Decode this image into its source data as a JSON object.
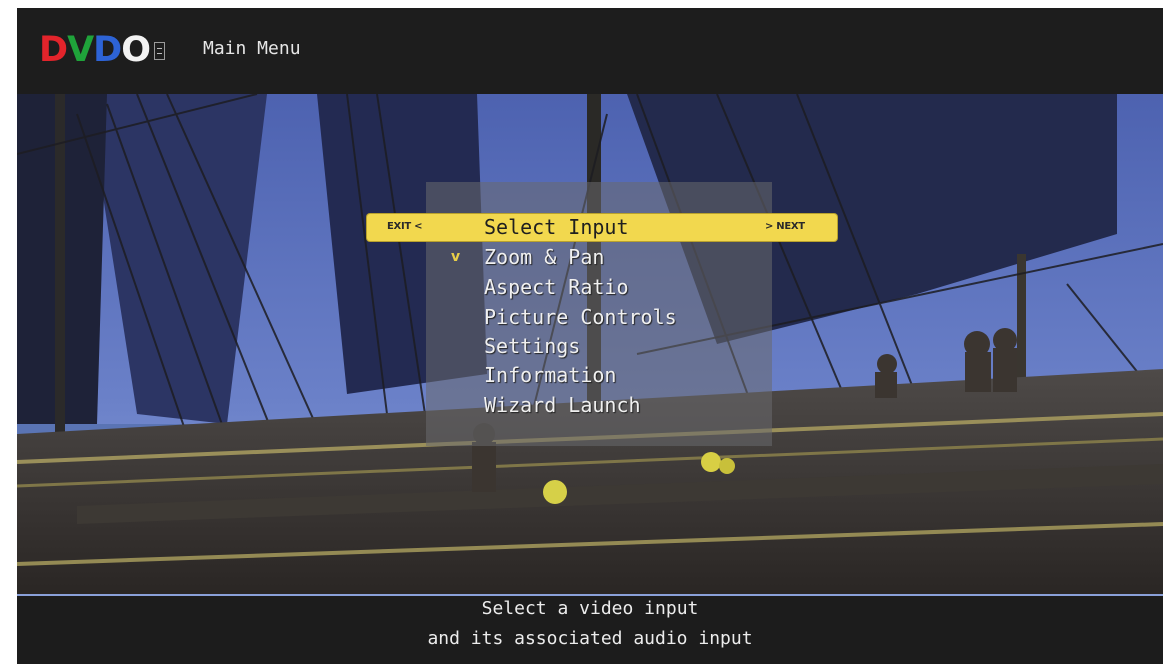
{
  "logo": {
    "letters": [
      "D",
      "V",
      "D",
      "O"
    ],
    "colors": [
      "#e3242b",
      "#1fa33a",
      "#2d63d6",
      "#f2f2f2"
    ]
  },
  "header": {
    "title": "Main Menu"
  },
  "menu": {
    "exit_label": "EXIT <",
    "next_label": "> NEXT",
    "scroll_indicator": "v",
    "items": [
      {
        "label": "Select Input"
      },
      {
        "label": "Zoom & Pan"
      },
      {
        "label": "Aspect Ratio"
      },
      {
        "label": "Picture Controls"
      },
      {
        "label": "Settings"
      },
      {
        "label": "Information"
      },
      {
        "label": "Wizard Launch"
      }
    ]
  },
  "help": {
    "line1": "Select a video input",
    "line2": "and its associated audio input"
  },
  "colors": {
    "highlight": "#f2d84e",
    "background": "#1c1c1c",
    "text": "#f0f0f0"
  }
}
